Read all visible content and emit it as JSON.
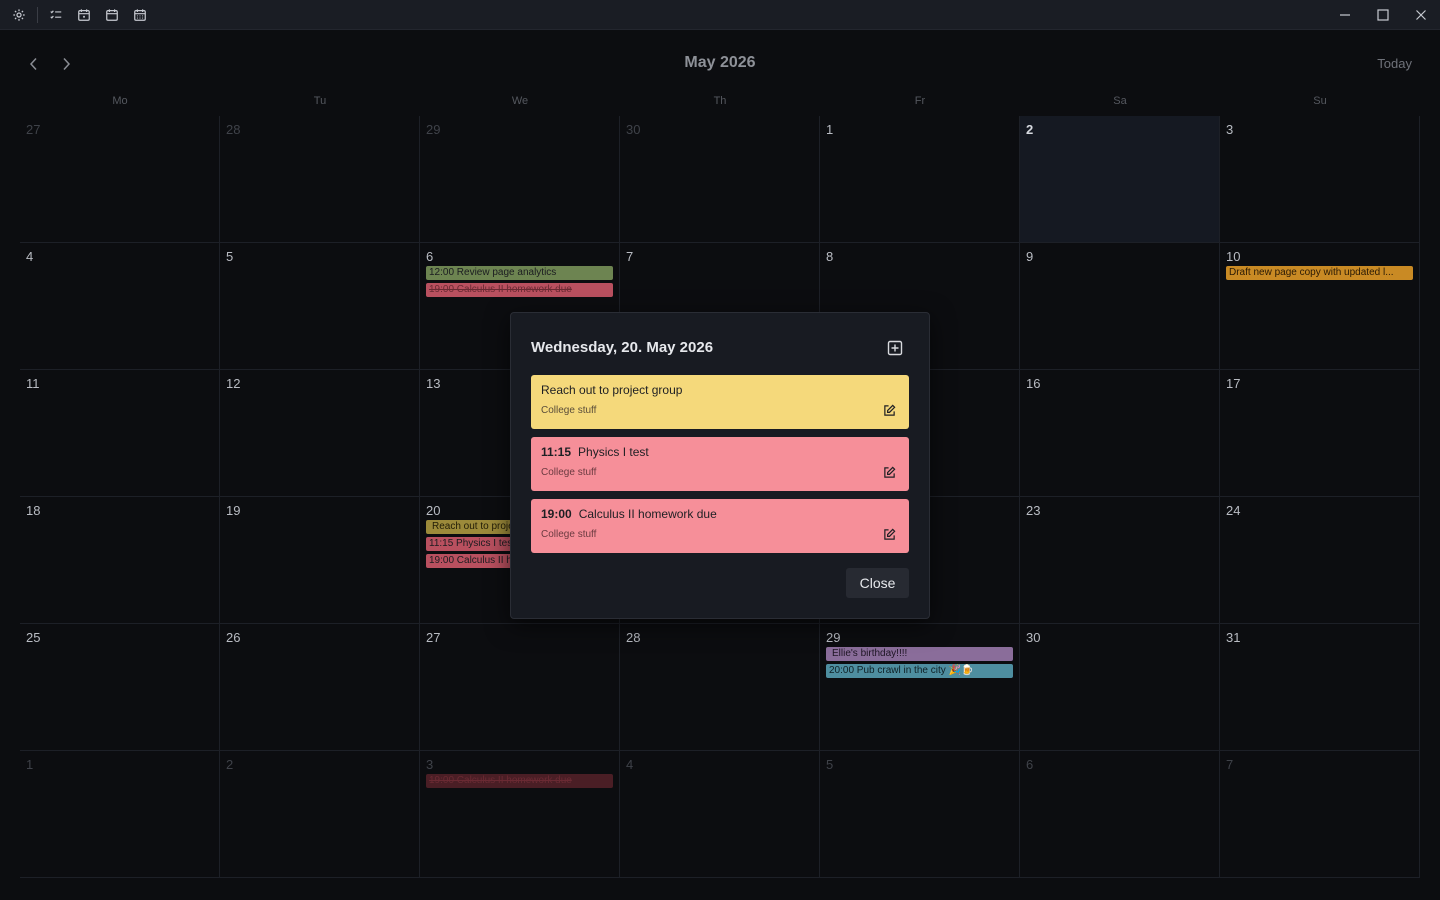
{
  "header": {
    "month_title": "May 2026",
    "today_label": "Today"
  },
  "weekdays": [
    "Mo",
    "Tu",
    "We",
    "Th",
    "Fr",
    "Sa",
    "Su"
  ],
  "weeks": [
    [
      "27",
      "28",
      "29",
      "30",
      "1",
      "2",
      "3"
    ],
    [
      "4",
      "5",
      "6",
      "7",
      "8",
      "9",
      "10"
    ],
    [
      "11",
      "12",
      "13",
      "14",
      "15",
      "16",
      "17"
    ],
    [
      "18",
      "19",
      "20",
      "21",
      "22",
      "23",
      "24"
    ],
    [
      "25",
      "26",
      "27",
      "28",
      "29",
      "30",
      "31"
    ],
    [
      "1",
      "2",
      "3",
      "4",
      "5",
      "6",
      "7"
    ]
  ],
  "events": {
    "may6_a": "12:00 Review page analytics",
    "may6_b": "19:00 Calculus II homework due",
    "may10_a": "Draft new page copy with updated l...",
    "may20_a": "Reach out to project group",
    "may20_b": "11:15 Physics I test",
    "may20_c": "19:00 Calculus II homework due",
    "may29_a": "Ellie's birthday!!!!",
    "may29_b": "20:00 Pub crawl in the city 🎉🍺",
    "jun3_a": "19:00 Calculus II homework due"
  },
  "modal": {
    "title": "Wednesday, 20. May 2026",
    "items": [
      {
        "time": "",
        "title": "Reach out to project group",
        "calendar": "College stuff"
      },
      {
        "time": "11:15",
        "title": "Physics I test",
        "calendar": "College stuff"
      },
      {
        "time": "19:00",
        "title": "Calculus II homework due",
        "calendar": "College stuff"
      }
    ],
    "close_label": "Close"
  },
  "colors": {
    "accent_yellow": "#f5d97b",
    "accent_pink": "#f68f99",
    "today_bg": "#151922"
  }
}
